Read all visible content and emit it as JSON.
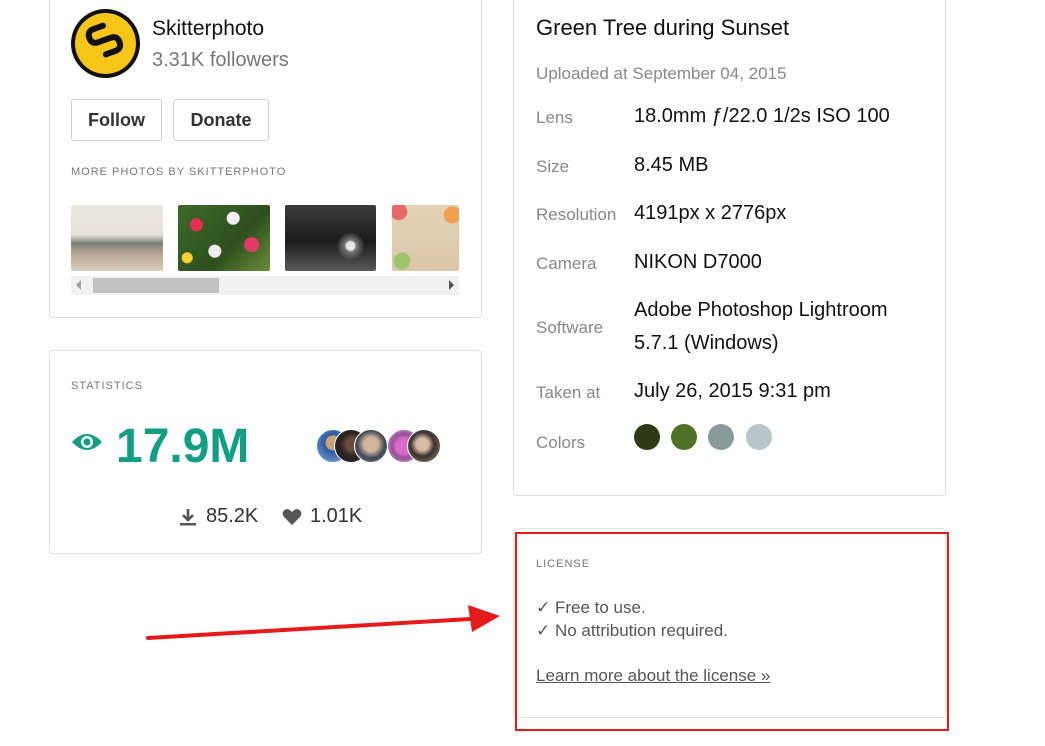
{
  "author": {
    "name": "Skitterphoto",
    "followers": "3.31K followers",
    "follow_label": "Follow",
    "donate_label": "Donate",
    "more_photos_label": "MORE PHOTOS BY SKITTERPHOTO",
    "thumbnails": [
      "living-room-photo",
      "flower-field-photo",
      "dark-lantern-photo",
      "floral-frame-photo"
    ]
  },
  "statistics": {
    "label": "STATISTICS",
    "views": "17.9M",
    "downloads": "85.2K",
    "likes": "1.01K",
    "accent_color": "#119e83"
  },
  "details": {
    "title": "Green Tree during Sunset",
    "uploaded": "Uploaded at September 04, 2015",
    "rows": [
      {
        "label": "Lens",
        "value": "18.0mm ƒ/22.0 1/2s ISO 100"
      },
      {
        "label": "Size",
        "value": "8.45 MB"
      },
      {
        "label": "Resolution",
        "value": "4191px x 2776px"
      },
      {
        "label": "Camera",
        "value": "NIKON D7000"
      },
      {
        "label": "Software",
        "value": "Adobe Photoshop Lightroom 5.7.1 (Windows)"
      },
      {
        "label": "Taken at",
        "value": "July 26, 2015 9:31 pm"
      }
    ],
    "colors_label": "Colors",
    "colors": [
      "#2c3b15",
      "#4f7225",
      "#8a9a9c",
      "#b8c6cb"
    ]
  },
  "license": {
    "label": "LICENSE",
    "line1": "✓ Free to use.",
    "line2": "✓ No attribution required.",
    "link": "Learn more about the license »"
  },
  "annotation": {
    "highlight_color": "#e51b1b"
  }
}
